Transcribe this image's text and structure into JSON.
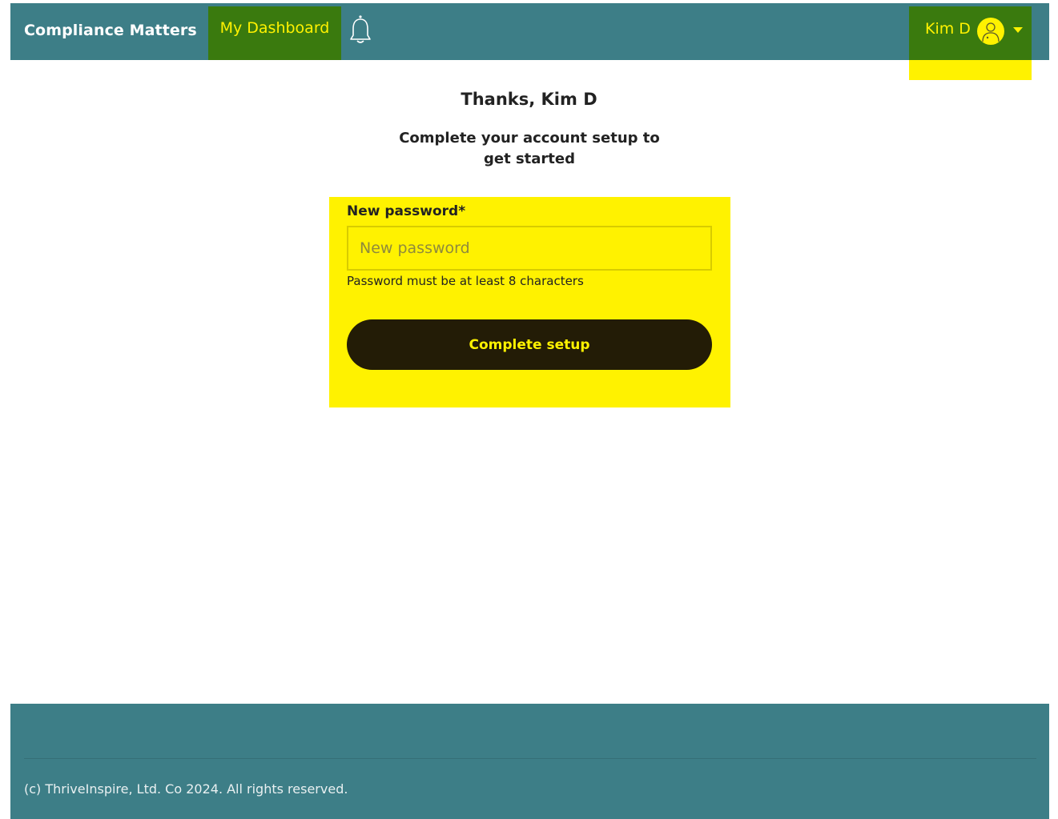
{
  "header": {
    "brand": "Compliance Matters",
    "nav": {
      "dashboard_label": "My Dashboard"
    },
    "notifications_icon": "bell-icon",
    "user": {
      "name": "Kim D",
      "avatar_icon": "user-avatar-icon",
      "menu_icon": "caret-down-icon"
    }
  },
  "main": {
    "heading": "Thanks, Kim D",
    "subheading": "Complete your account setup to get started",
    "form": {
      "password_label": "New password*",
      "password_placeholder": "New password",
      "password_value": "",
      "password_hint": "Password must be at least 8 characters",
      "submit_label": "Complete setup"
    }
  },
  "footer": {
    "copyright": "(c) ThriveInspire, Ltd. Co 2024. All rights reserved."
  },
  "colors": {
    "header_bg": "#3d7e87",
    "nav_active_bg": "#3a7a0e",
    "accent_yellow": "#fff200",
    "button_bg": "#231c06"
  }
}
